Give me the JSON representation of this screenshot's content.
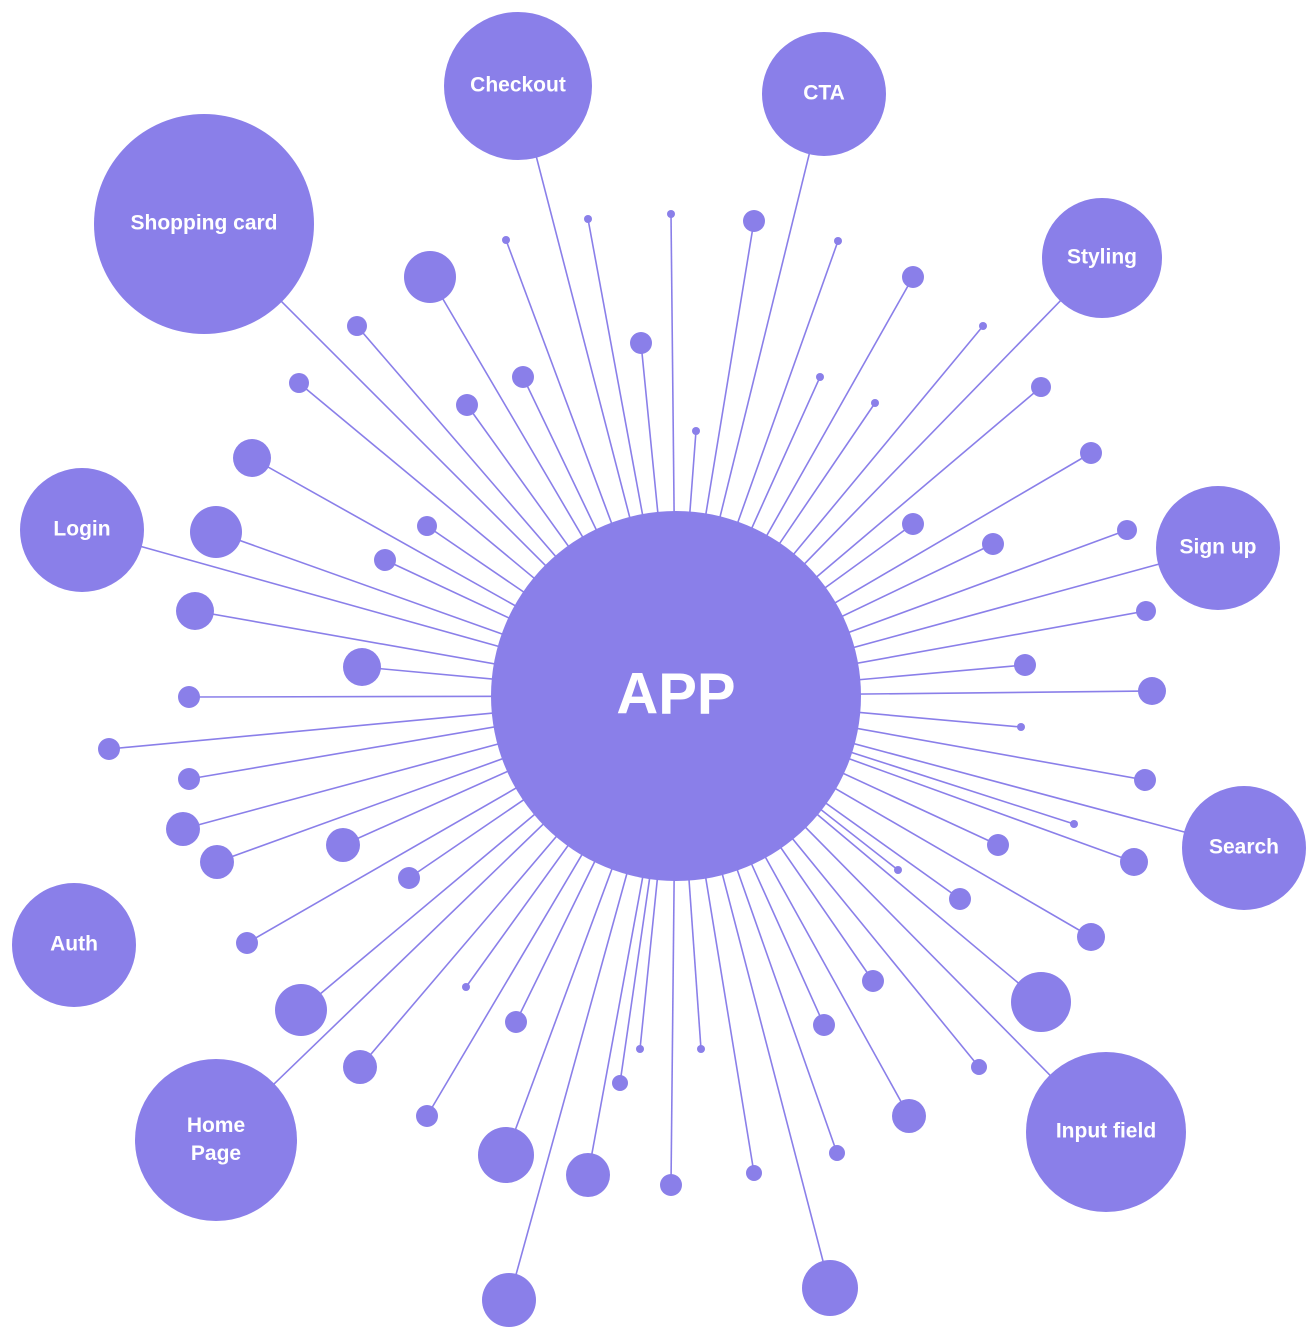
{
  "diagram": {
    "type": "hub-and-spoke",
    "center": {
      "label": "APP"
    },
    "nodes": [
      {
        "id": "checkout",
        "label": "Checkout"
      },
      {
        "id": "cta",
        "label": "CTA"
      },
      {
        "id": "shopping-card",
        "label": "Shopping card"
      },
      {
        "id": "styling",
        "label": "Styling"
      },
      {
        "id": "login",
        "label": "Login"
      },
      {
        "id": "sign-up",
        "label": "Sign up"
      },
      {
        "id": "search",
        "label": "Search"
      },
      {
        "id": "auth",
        "label": "Auth"
      },
      {
        "id": "home-page",
        "label": "Home\nPage"
      },
      {
        "id": "input-field",
        "label": "Input field"
      }
    ],
    "colors": {
      "primary": "#8a7fe9",
      "text": "#ffffff",
      "background": "#ffffff"
    }
  }
}
